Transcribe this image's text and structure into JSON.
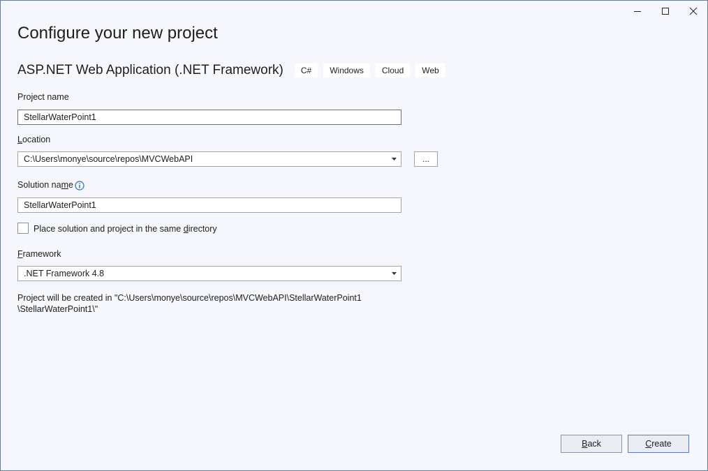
{
  "window": {
    "controls": [
      "minimize-icon",
      "maximize-icon",
      "close-icon"
    ]
  },
  "page_title": "Configure your new project",
  "template": {
    "name": "ASP.NET Web Application (.NET Framework)",
    "tags": [
      "C#",
      "Windows",
      "Cloud",
      "Web"
    ]
  },
  "project_name": {
    "label": "Project name",
    "value": "StellarWaterPoint1"
  },
  "location": {
    "label_pre": "",
    "label_key": "L",
    "label_post": "ocation",
    "value": "C:\\Users\\monye\\source\\repos\\MVCWebAPI",
    "browse_label": "..."
  },
  "solution_name": {
    "label_pre": "Solution na",
    "label_key": "m",
    "label_post": "e",
    "value": "StellarWaterPoint1",
    "info_icon": "info-icon"
  },
  "same_directory": {
    "label_pre": "Place solution and project in the same ",
    "label_key": "d",
    "label_post": "irectory",
    "checked": false
  },
  "framework": {
    "label_pre": "",
    "label_key": "F",
    "label_post": "ramework",
    "value": ".NET Framework 4.8"
  },
  "summary": {
    "line1": "Project will be created in \"C:\\Users\\monye\\source\\repos\\MVCWebAPI\\StellarWaterPoint1",
    "line2": "\\StellarWaterPoint1\\\""
  },
  "buttons": {
    "back_key": "B",
    "back_rest": "ack",
    "create_key": "C",
    "create_rest": "reate"
  },
  "colors": {
    "background": "#f5f7fc",
    "info_icon": "#1e6fc2",
    "primary_border": "#5c7bbf"
  }
}
